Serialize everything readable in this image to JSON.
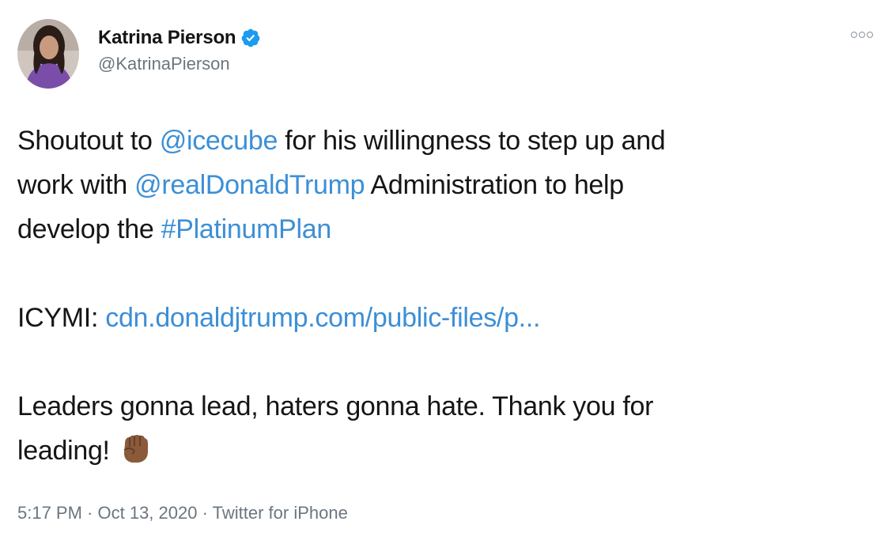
{
  "author": {
    "display_name": "Katrina Pierson",
    "handle": "@KatrinaPierson",
    "verified": true
  },
  "tweet": {
    "line1_pre": "Shoutout to ",
    "mention1": "@icecube",
    "line1_post": " for his willingness to step up and",
    "line2_pre": "work with ",
    "mention2": "@realDonaldTrump",
    "line2_post": " Administration to help",
    "line3_pre": "develop the ",
    "hashtag": "#PlatinumPlan",
    "icymi_label": "ICYMI: ",
    "url": "cdn.donaldjtrump.com/public-files/p...",
    "closing_line1": "Leaders gonna lead, haters gonna hate. Thank you for",
    "closing_line2": "leading!",
    "emoji": "raised-fist-medium-dark-skin"
  },
  "meta": {
    "time": "5:17 PM",
    "separator": " · ",
    "date": "Oct 13, 2020",
    "source": "Twitter for iPhone"
  },
  "colors": {
    "link": "#3c8fd6",
    "verified_badge": "#1d9bf0",
    "secondary_text": "#6b7580"
  }
}
